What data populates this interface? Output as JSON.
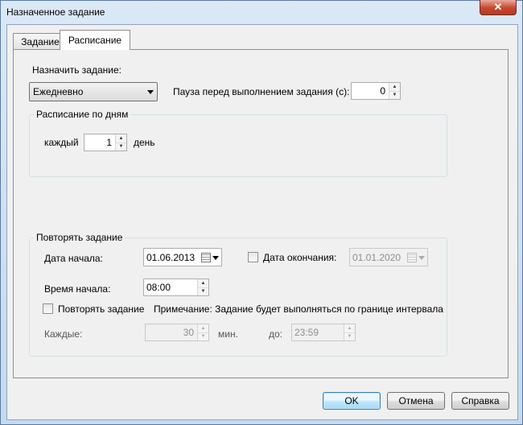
{
  "window": {
    "title": "Назначенное задание",
    "close_glyph": "✕"
  },
  "tabs": [
    {
      "label": "Задание"
    },
    {
      "label": "Расписание"
    }
  ],
  "schedule": {
    "assign_label": "Назначить задание:",
    "frequency_value": "Ежедневно",
    "pause_label": "Пауза перед выполнением задания (с):",
    "pause_value": "0",
    "by_days": {
      "title": "Расписание по дням",
      "every_label": "каждый",
      "every_value": "1",
      "unit": "день"
    },
    "repeat": {
      "title": "Повторять задание",
      "start_date_label": "Дата начала:",
      "start_date_value": "01.06.2013",
      "end_date_label": "Дата окончания:",
      "end_date_value": "01.01.2020",
      "start_time_label": "Время начала:",
      "start_time_value": "08:00",
      "repeat_task_label": "Повторять задание",
      "note": "Примечание: Задание будет выполняться по границе интервала",
      "every_label": "Каждые:",
      "every_value": "30",
      "min_label": "мин.",
      "until_label": "до:",
      "until_value": "23:59"
    }
  },
  "buttons": {
    "ok": "OK",
    "cancel": "Отмена",
    "help": "Справка"
  },
  "icons": {
    "spin_up": "▲",
    "spin_down": "▼"
  }
}
